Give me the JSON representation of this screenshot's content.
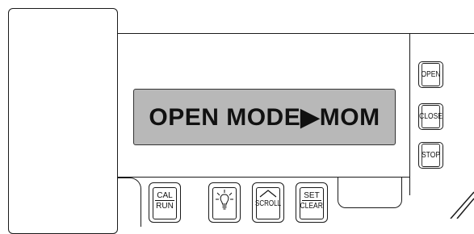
{
  "display": {
    "text": "OPEN MODE▶MOM"
  },
  "side_buttons": {
    "open": "OPEN",
    "close": "CLOSE",
    "stop": "STOP"
  },
  "bottom_buttons": {
    "cal_top": "CAL",
    "cal_bottom": "RUN",
    "scroll": "SCROLL",
    "set_top": "SET",
    "set_bottom": "CLEAR"
  }
}
